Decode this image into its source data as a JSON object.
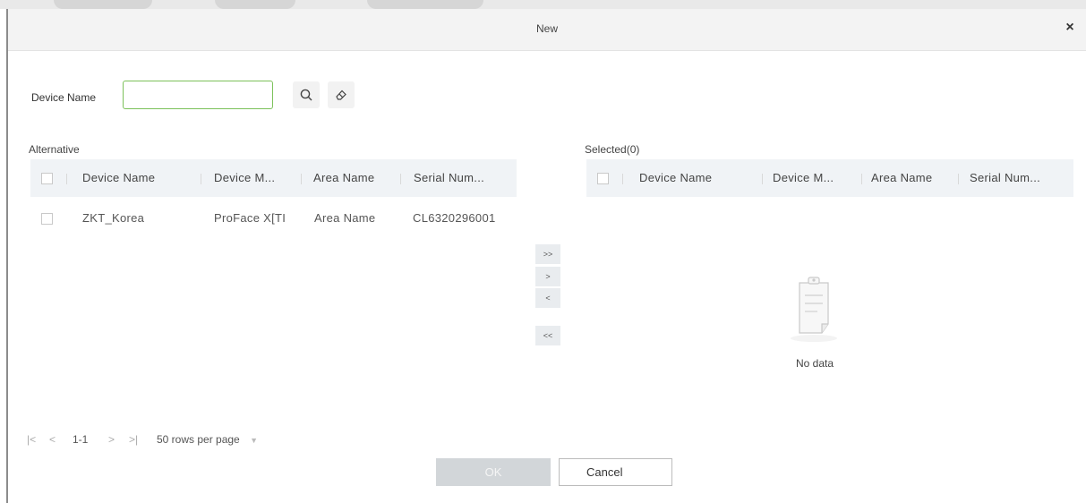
{
  "dialog": {
    "title": "New",
    "close_icon": "close-icon"
  },
  "search": {
    "label": "Device Name",
    "value": "",
    "search_icon": "search-icon",
    "clear_icon": "eraser-icon"
  },
  "alternative": {
    "label": "Alternative",
    "columns": [
      "Device Name",
      "Device M...",
      "Area Name",
      "Serial Num..."
    ],
    "rows": [
      {
        "device_name": "ZKT_Korea",
        "device_model": "ProFace X[TI",
        "area_name": "Area Name",
        "serial_number": "CL6320296001"
      }
    ]
  },
  "transfer": {
    "move_all_right": ">>",
    "move_right": ">",
    "move_left": "<",
    "move_all_left": "<<"
  },
  "selected": {
    "label": "Selected(0)",
    "columns": [
      "Device Name",
      "Device M...",
      "Area Name",
      "Serial Num..."
    ],
    "empty_text": "No data"
  },
  "pagination": {
    "first": "|<",
    "prev": "<",
    "range": "1-1",
    "next": ">",
    "last": ">|",
    "page_size": "50 rows per page",
    "dropdown_icon": "caret-down-icon"
  },
  "footer": {
    "ok_label": "OK",
    "cancel_label": "Cancel"
  }
}
